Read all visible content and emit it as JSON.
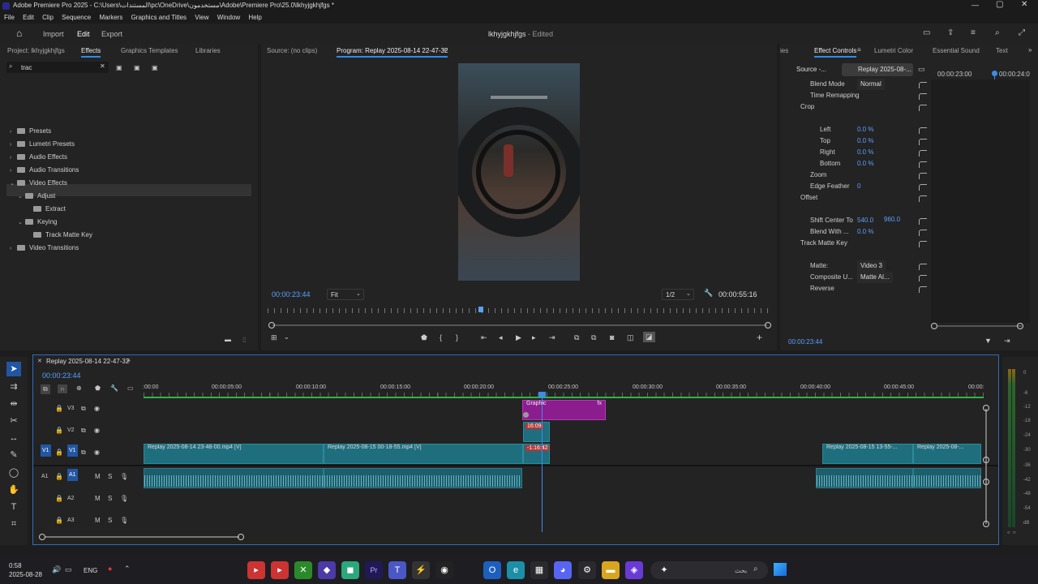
{
  "titlebar": {
    "app_title": "Adobe Premiere Pro 2025 - C:\\Users\\المستندات\\pc\\OneDrive\\مستخدمون\\Adobe\\Premiere Pro\\25.0\\lkhyjgkhjfgs *"
  },
  "menu": [
    "File",
    "Edit",
    "Clip",
    "Sequence",
    "Markers",
    "Graphics and Titles",
    "View",
    "Window",
    "Help"
  ],
  "workspace": {
    "import": "Import",
    "edit": "Edit",
    "export": "Export",
    "project_title": "lkhyjgkhjfgs",
    "edited": "- Edited"
  },
  "project_panel": {
    "tabs": [
      "Project: lkhyjgkhjfgs",
      "Effects",
      "Graphics Templates",
      "Libraries"
    ],
    "search_value": "trac",
    "tree": [
      {
        "label": "Presets",
        "indent": 0,
        "open": false
      },
      {
        "label": "Lumetri Presets",
        "indent": 0,
        "open": false
      },
      {
        "label": "Audio Effects",
        "indent": 0,
        "open": false
      },
      {
        "label": "Audio Transitions",
        "indent": 0,
        "open": false
      },
      {
        "label": "Video Effects",
        "indent": 0,
        "open": true
      },
      {
        "label": "Adjust",
        "indent": 1,
        "open": true
      },
      {
        "label": "Extract",
        "indent": 2,
        "open": false
      },
      {
        "label": "Keying",
        "indent": 1,
        "open": true
      },
      {
        "label": "Track Matte Key",
        "indent": 2,
        "open": false
      },
      {
        "label": "Video Transitions",
        "indent": 0,
        "open": false
      }
    ]
  },
  "program": {
    "source_tab": "Source: (no clips)",
    "program_tab": "Program: Replay 2025-08-14 22-47-32",
    "timecode": "00:00:23:44",
    "fit": "Fit",
    "resolution": "1/2",
    "duration": "00:00:55:16"
  },
  "effect_controls": {
    "tabs": [
      "ies",
      "Effect Controls",
      "Lumetri Color",
      "Essential Sound",
      "Text"
    ],
    "source": "Source -...",
    "sequence": "Replay 2025-08-...",
    "ruler": [
      "00:00:23:00",
      "00:00:24:0"
    ],
    "rows": [
      {
        "label": "Blend Mode",
        "value": "Normal"
      },
      {
        "label": "Time Remapping",
        "value": ""
      },
      {
        "label": "Crop",
        "value": ""
      },
      {
        "label": "Left",
        "value": "0.0 %"
      },
      {
        "label": "Top",
        "value": "0.0 %"
      },
      {
        "label": "Right",
        "value": "0.0 %"
      },
      {
        "label": "Bottom",
        "value": "0.0 %"
      },
      {
        "label": "Zoom",
        "value": ""
      },
      {
        "label": "Edge Feather",
        "value": "0"
      },
      {
        "label": "Offset",
        "value": ""
      },
      {
        "label": "Shift Center To",
        "value": "540.0"
      },
      {
        "label": "Blend With ...",
        "value": "0.0 %"
      },
      {
        "label": "Track Matte Key",
        "value": ""
      },
      {
        "label": "Matte:",
        "value": "Video 3"
      },
      {
        "label": "Composite U...",
        "value": "Matte Al..."
      },
      {
        "label": "Reverse",
        "value": ""
      }
    ],
    "shift_y": "960.0",
    "bottom_timecode": "00:00:23:44"
  },
  "timeline": {
    "sequence_tab": "Replay 2025-08-14 22-47-32",
    "timecode": "00:00:23:44",
    "ruler": [
      ":00:00",
      "00:00:05:00",
      "00:00:10:00",
      "00:00:15:00",
      "00:00:20:00",
      "00:00:25:00",
      "00:00:30:00",
      "00:00:35:00",
      "00:00:40:00",
      "00:00:45:00",
      "00:00:"
    ],
    "tracks": [
      "V3",
      "V2",
      "V1",
      "A1",
      "A2",
      "A3"
    ],
    "clips": {
      "graphic": "Graphic",
      "v2_badge": "16:09",
      "v1_badge": "-1:16:42",
      "c1": "Replay 2025-08-14 23-48-00.mp4 [V]",
      "c2": "Replay 2025-08-15 00-18-55.mp4 [V]",
      "c3": "Replay 2025-08-15 13-55-...",
      "c4": "Replay 2025-08-..."
    },
    "meter": [
      "0",
      "-6",
      "-12",
      "-18",
      "-24",
      "-30",
      "-36",
      "-42",
      "-48",
      "-54",
      "dB"
    ]
  },
  "taskbar": {
    "time": "0:58",
    "date": "2025-08-28",
    "lang": "ENG",
    "search": "بحث"
  }
}
